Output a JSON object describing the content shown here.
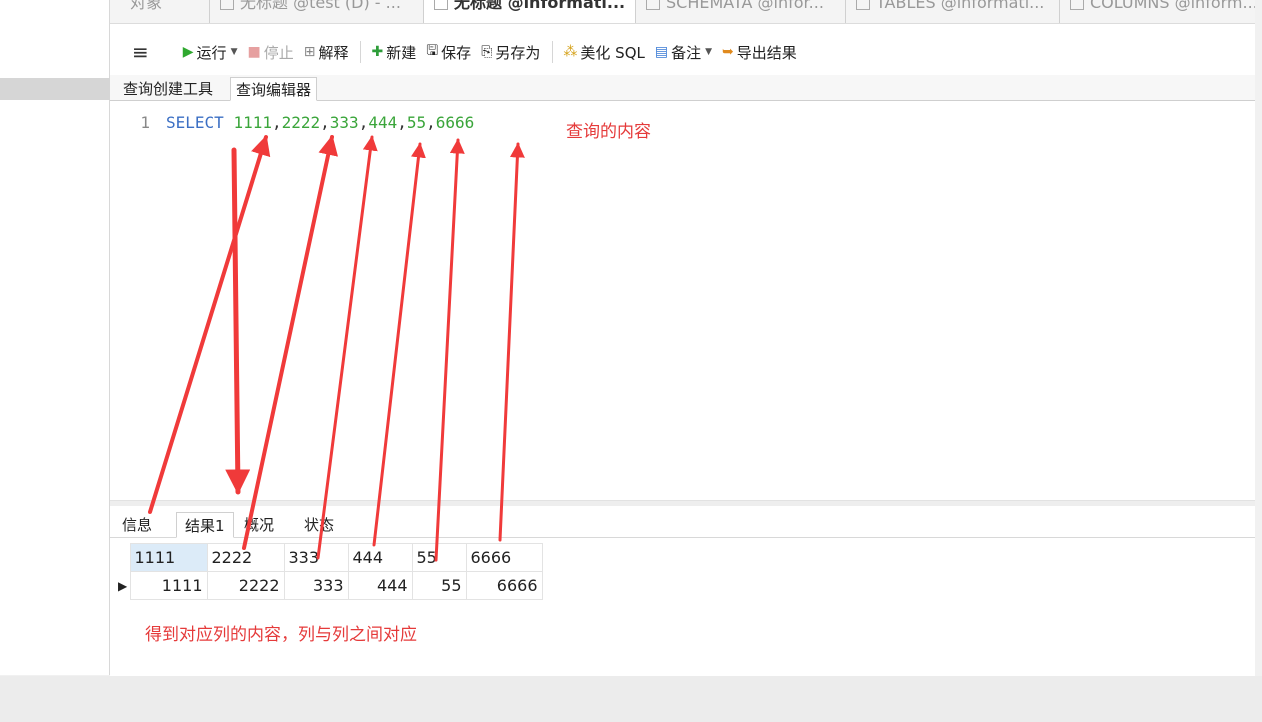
{
  "tabs": [
    {
      "label": "对象",
      "active": false
    },
    {
      "label": "无标题 @test (D) - ...",
      "active": false
    },
    {
      "label": "无标题 @informati...",
      "active": true
    },
    {
      "label": "SCHEMATA @infor...",
      "active": false
    },
    {
      "label": "TABLES @informati...",
      "active": false
    },
    {
      "label": "COLUMNS @inform...",
      "active": false
    }
  ],
  "toolbar": {
    "run": "运行",
    "stop": "停止",
    "explain": "解释",
    "new": "新建",
    "save": "保存",
    "save_as": "另存为",
    "beautify": "美化 SQL",
    "comment": "备注",
    "export": "导出结果"
  },
  "subtabs": [
    "查询创建工具",
    "查询编辑器"
  ],
  "editor": {
    "line_number": "1",
    "keyword": "SELECT",
    "values": [
      "1111",
      "2222",
      "333",
      "444",
      "55",
      "6666"
    ]
  },
  "results_tabs": [
    "信息",
    "结果1",
    "概况",
    "状态"
  ],
  "grid": {
    "columns": [
      "1111",
      "2222",
      "333",
      "444",
      "55",
      "6666"
    ],
    "rows": [
      [
        "1111",
        "2222",
        "333",
        "444",
        "55",
        "6666"
      ]
    ]
  },
  "annotations": {
    "query_label": "查询的内容",
    "result_label": "得到对应列的内容，列与列之间对应"
  },
  "colors": {
    "annotation": "#e53a3a",
    "keyword": "#3b6fc4",
    "number": "#3aa53a",
    "header_selected": "#dcebf8"
  }
}
